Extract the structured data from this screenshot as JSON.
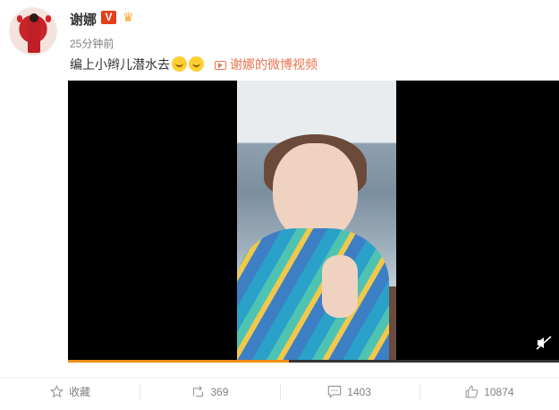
{
  "post": {
    "author": "谢娜",
    "verified_badge": "V",
    "time": "25分钟前",
    "text": "编上小辫儿潜水去",
    "video_link": "谢娜的微博视频"
  },
  "icons": {
    "avatar": "avatar-image",
    "verified": "verified-v-icon",
    "member": "crown-icon",
    "video": "video-icon",
    "mute": "mute-icon",
    "favorite": "star-icon",
    "repost": "repost-icon",
    "comment": "comment-icon",
    "like": "thumbs-up-icon"
  },
  "video": {
    "progress": 0.45
  },
  "actions": {
    "favorite_label": "收藏",
    "repost_count": "369",
    "comment_count": "1403",
    "like_count": "10874"
  },
  "colors": {
    "accent": "#eb7350",
    "progress": "#f08c15",
    "verified": "#e63e1a"
  }
}
